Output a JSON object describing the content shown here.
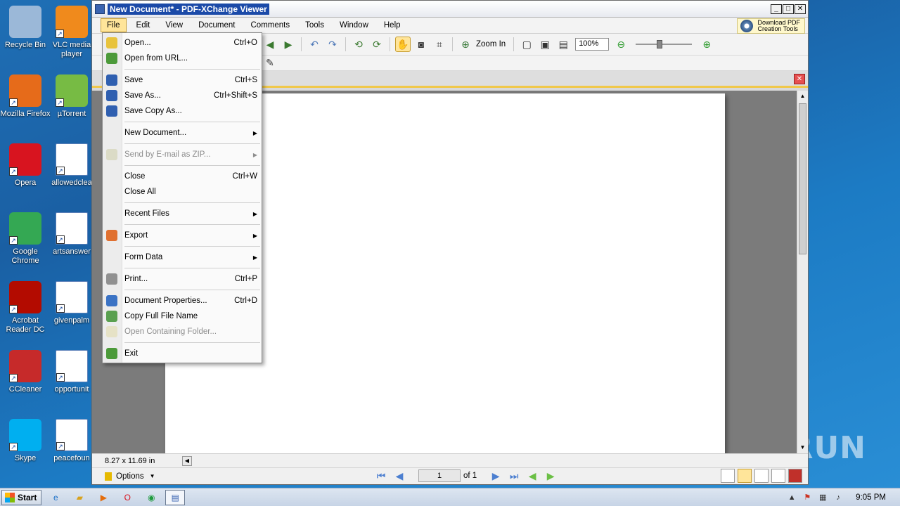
{
  "desktop": {
    "icons": [
      {
        "label": "Recycle Bin",
        "icon": "recycle-bin-icon"
      },
      {
        "label": "VLC media player",
        "icon": "vlc-icon"
      },
      {
        "label": "Mozilla Firefox",
        "icon": "firefox-icon"
      },
      {
        "label": "µTorrent",
        "icon": "utorrent-icon"
      },
      {
        "label": "Opera",
        "icon": "opera-icon"
      },
      {
        "label": "allowedclea",
        "icon": "word-doc-icon"
      },
      {
        "label": "Google Chrome",
        "icon": "chrome-icon"
      },
      {
        "label": "artsanswer",
        "icon": "word-doc-icon"
      },
      {
        "label": "Acrobat Reader DC",
        "icon": "acrobat-icon"
      },
      {
        "label": "givenpalm",
        "icon": "word-doc-icon"
      },
      {
        "label": "CCleaner",
        "icon": "ccleaner-icon"
      },
      {
        "label": "opportunit",
        "icon": "word-doc-icon"
      },
      {
        "label": "Skype",
        "icon": "skype-icon"
      },
      {
        "label": "peacefoun",
        "icon": "word-doc-icon"
      }
    ],
    "watermark": "ANY RUN"
  },
  "window": {
    "title": "New Document* - PDF-XChange Viewer",
    "minimize": "_",
    "maximize": "□",
    "close": "✕"
  },
  "menubar": {
    "items": [
      "File",
      "Edit",
      "View",
      "Document",
      "Comments",
      "Tools",
      "Window",
      "Help"
    ],
    "promo_line1": "Download PDF",
    "promo_line2": "Creation Tools"
  },
  "toolbar": {
    "zoom_in_label": "Zoom In",
    "zoom_value": "100%",
    "zoom_slider_fraction": 0.42
  },
  "file_menu": {
    "items": [
      {
        "label": "Open...",
        "shortcut": "Ctrl+O",
        "icon": "open-folder-icon",
        "disabled": false
      },
      {
        "label": "Open from URL...",
        "shortcut": "",
        "icon": "globe-icon",
        "disabled": false
      },
      {
        "sep": true
      },
      {
        "label": "Save",
        "shortcut": "Ctrl+S",
        "icon": "save-icon",
        "disabled": false
      },
      {
        "label": "Save As...",
        "shortcut": "Ctrl+Shift+S",
        "icon": "save-as-icon",
        "disabled": false
      },
      {
        "label": "Save Copy As...",
        "shortcut": "",
        "icon": "save-copy-icon",
        "disabled": false
      },
      {
        "sep": true
      },
      {
        "label": "New Document...",
        "shortcut": "",
        "submenu": true,
        "disabled": false
      },
      {
        "sep": true
      },
      {
        "label": "Send by E-mail as ZIP...",
        "shortcut": "",
        "submenu": true,
        "icon": "email-zip-icon",
        "disabled": true
      },
      {
        "sep": true
      },
      {
        "label": "Close",
        "shortcut": "Ctrl+W",
        "disabled": false
      },
      {
        "label": "Close All",
        "shortcut": "",
        "disabled": false
      },
      {
        "sep": true
      },
      {
        "label": "Recent Files",
        "shortcut": "",
        "submenu": true,
        "disabled": false
      },
      {
        "sep": true
      },
      {
        "label": "Export",
        "shortcut": "",
        "submenu": true,
        "icon": "export-icon",
        "disabled": false
      },
      {
        "sep": true
      },
      {
        "label": "Form Data",
        "shortcut": "",
        "submenu": true,
        "disabled": false
      },
      {
        "sep": true
      },
      {
        "label": "Print...",
        "shortcut": "Ctrl+P",
        "icon": "printer-icon",
        "disabled": false
      },
      {
        "sep": true
      },
      {
        "label": "Document Properties...",
        "shortcut": "Ctrl+D",
        "icon": "properties-icon",
        "disabled": false
      },
      {
        "label": "Copy Full File Name",
        "shortcut": "",
        "icon": "copy-icon",
        "disabled": false
      },
      {
        "label": "Open Containing Folder...",
        "shortcut": "",
        "icon": "folder-icon",
        "disabled": true
      },
      {
        "sep": true
      },
      {
        "label": "Exit",
        "shortcut": "",
        "icon": "exit-icon",
        "disabled": false
      }
    ]
  },
  "status": {
    "page_size": "8.27 x 11.69 in"
  },
  "navbar": {
    "options_label": "Options",
    "page_number": "1",
    "page_of": "of 1"
  },
  "taskbar": {
    "start_label": "Start",
    "clock": "9:05 PM"
  }
}
